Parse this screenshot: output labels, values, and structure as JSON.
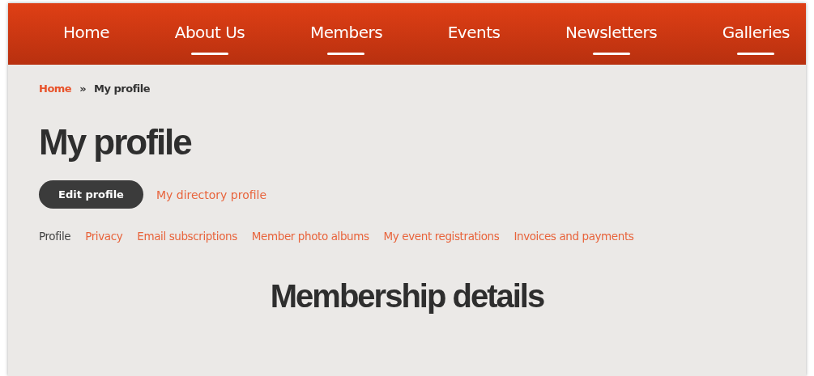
{
  "nav": [
    {
      "label": "Home",
      "has_submenu": false
    },
    {
      "label": "About Us",
      "has_submenu": true
    },
    {
      "label": "Members",
      "has_submenu": true
    },
    {
      "label": "Events",
      "has_submenu": false
    },
    {
      "label": "Newsletters",
      "has_submenu": true
    },
    {
      "label": "Galleries",
      "has_submenu": true
    }
  ],
  "breadcrumb": [
    {
      "label": "Home",
      "link": true
    },
    {
      "label": "»",
      "link": false
    },
    {
      "label": "My profile",
      "link": false
    }
  ],
  "title": "My profile",
  "profile_views": [
    {
      "label": "Edit profile",
      "selected": true
    },
    {
      "label": "My directory profile",
      "selected": false
    }
  ],
  "tabs": [
    {
      "label": "Profile",
      "selected": true
    },
    {
      "label": "Privacy",
      "selected": false
    },
    {
      "label": "Email subscriptions",
      "selected": false
    },
    {
      "label": "Member photo albums",
      "selected": false
    },
    {
      "label": "My event registrations",
      "selected": false
    },
    {
      "label": "Invoices and payments",
      "selected": false
    }
  ],
  "section_title": "Membership details"
}
